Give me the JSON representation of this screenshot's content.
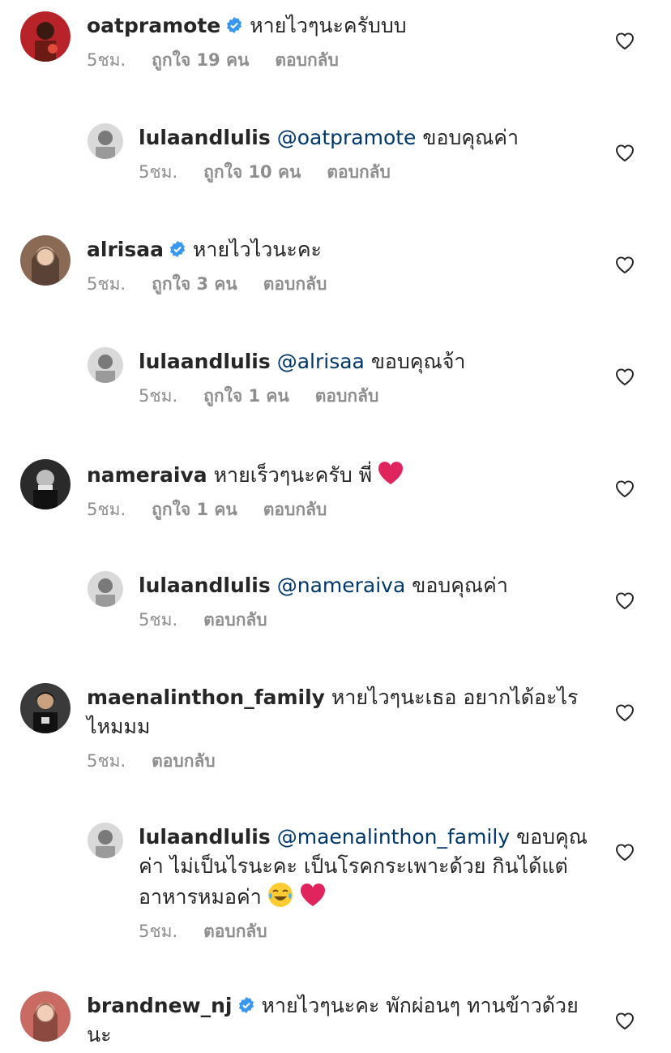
{
  "comments": [
    {
      "username": "oatpramote",
      "verified": true,
      "mention": "",
      "text": "หายไวๆนะครับบบ",
      "time": "5ชม.",
      "likes": "ถูกใจ 19 คน",
      "reply_label": "ตอบกลับ",
      "reply": false
    },
    {
      "username": "lulaandlulis",
      "verified": false,
      "mention": "@oatpramote",
      "text": "ขอบคุณค่า",
      "time": "5ชม.",
      "likes": "ถูกใจ 10 คน",
      "reply_label": "ตอบกลับ",
      "reply": true
    },
    {
      "username": "alrisaa",
      "verified": true,
      "mention": "",
      "text": "หายไวไวนะคะ",
      "time": "5ชม.",
      "likes": "ถูกใจ 3 คน",
      "reply_label": "ตอบกลับ",
      "reply": false
    },
    {
      "username": "lulaandlulis",
      "verified": false,
      "mention": "@alrisaa",
      "text": "ขอบคุณจ้า",
      "time": "5ชม.",
      "likes": "ถูกใจ 1 คน",
      "reply_label": "ตอบกลับ",
      "reply": true
    },
    {
      "username": "nameraiva",
      "verified": false,
      "mention": "",
      "text": "หายเร็วๆนะครับ พี่",
      "time": "5ชม.",
      "likes": "ถูกใจ 1 คน",
      "reply_label": "ตอบกลับ",
      "reply": false,
      "emoji": [
        "heart"
      ]
    },
    {
      "username": "lulaandlulis",
      "verified": false,
      "mention": "@nameraiva",
      "text": "ขอบคุณค่า",
      "time": "5ชม.",
      "likes": "",
      "reply_label": "ตอบกลับ",
      "reply": true
    },
    {
      "username": "maenalinthon_family",
      "verified": false,
      "mention": "",
      "text": "หายไวๆนะเธอ อยากได้อะไรไหมมม",
      "time": "5ชม.",
      "likes": "",
      "reply_label": "ตอบกลับ",
      "reply": false
    },
    {
      "username": "lulaandlulis",
      "verified": false,
      "mention": "@maenalinthon_family",
      "text": "ขอบคุณค่า ไม่เป็นไรนะคะ เป็นโรคกระเพาะด้วย กินได้แต่อาหารหมอค่า",
      "time": "5ชม.",
      "likes": "",
      "reply_label": "ตอบกลับ",
      "reply": true,
      "emoji": [
        "joy",
        "heart"
      ]
    },
    {
      "username": "brandnew_nj",
      "verified": true,
      "mention": "",
      "text": "หายไวๆนะคะ พักผ่อนๆ ทานข้าวด้วยนะ",
      "time": "",
      "likes": "",
      "reply_label": "",
      "reply": false
    }
  ],
  "colors": {
    "text": "#262626",
    "meta": "#8e8e8e",
    "mention": "#00376b",
    "verified": "#3897f0",
    "heart_emoji": "#e0245e"
  }
}
